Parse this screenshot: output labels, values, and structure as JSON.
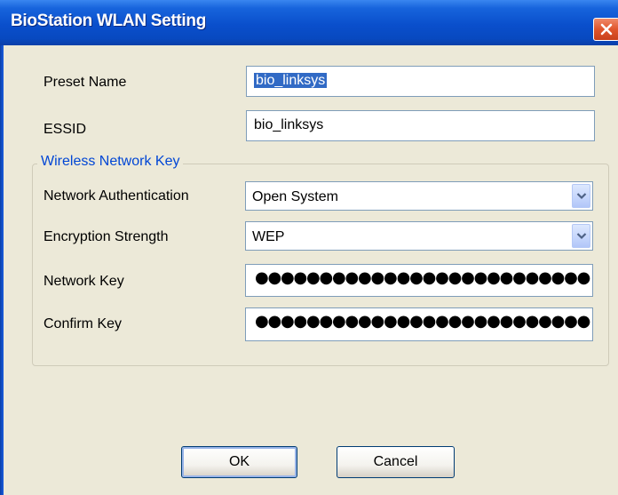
{
  "window": {
    "title": "BioStation WLAN Setting",
    "close_icon": "close-icon"
  },
  "fields": {
    "preset_name_label": "Preset Name",
    "preset_name_value": "bio_linksys",
    "essid_label": "ESSID",
    "essid_value": "bio_linksys"
  },
  "wireless_key": {
    "group_title": "Wireless Network Key",
    "auth_label": "Network Authentication",
    "auth_value": "Open System",
    "encryption_label": "Encryption Strength",
    "encryption_value": "WEP",
    "network_key_label": "Network Key",
    "network_key_masked": "●●●●●●●●●●●●●●●●●●●●●●●●●●",
    "confirm_key_label": "Confirm Key",
    "confirm_key_masked": "●●●●●●●●●●●●●●●●●●●●●●●●●●"
  },
  "buttons": {
    "ok": "OK",
    "cancel": "Cancel"
  },
  "colors": {
    "title_bar": "#0a4fcc",
    "selection": "#316ac5",
    "group_title": "#0046d5",
    "dialog_bg": "#ece9d8"
  }
}
